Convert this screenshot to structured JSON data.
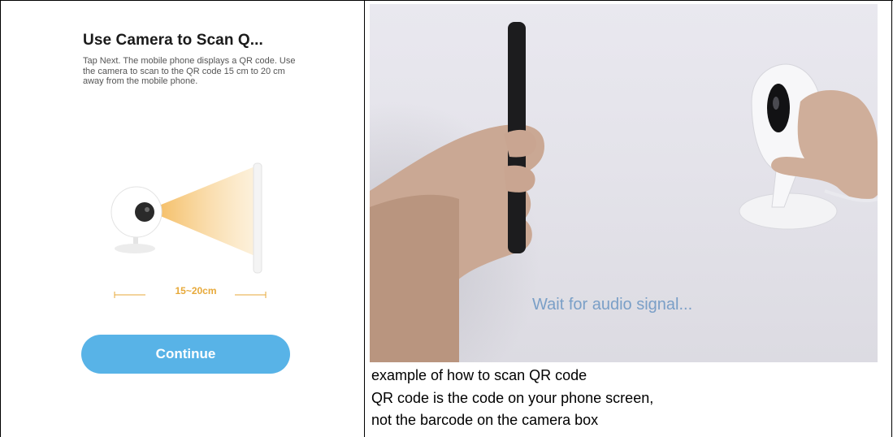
{
  "app_screen": {
    "title": "Use Camera to Scan Q...",
    "description": "Tap Next. The mobile phone displays a QR code. Use the camera to scan to the QR code 15 cm to 20 cm away from the mobile phone.",
    "distance_label": "15~20cm",
    "continue_label": "Continue",
    "accent_color": "#58b3e7",
    "beam_color": "#f6c56a"
  },
  "example_photo": {
    "overlay_caption": "Wait for audio signal..."
  },
  "notes": [
    "example of how to scan QR code",
    "QR code is the code on your phone screen,",
    "not the barcode on the camera box"
  ]
}
